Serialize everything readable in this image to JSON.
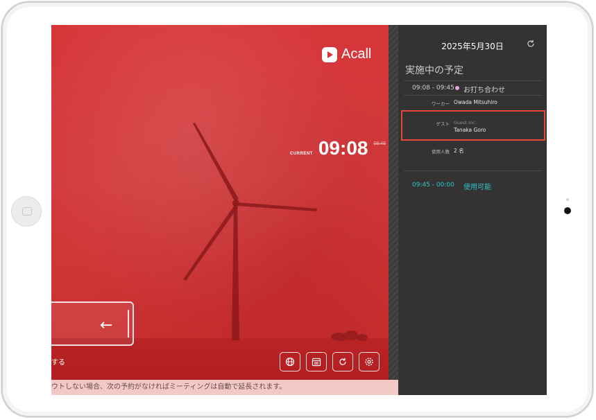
{
  "brand": {
    "name": "Acall"
  },
  "clock": {
    "label": "CURRENT",
    "time": "09:08",
    "end_time": "09:45"
  },
  "checkout": {
    "label": "する"
  },
  "toolbar": {
    "icons": [
      "globe-icon",
      "calendar-icon",
      "refresh-icon",
      "gear-icon"
    ]
  },
  "notice": {
    "text": "ウトしない場合、次の予約がなければミーティングは自動で延長されます。"
  },
  "schedule": {
    "date": "2025年5月30日",
    "section_title": "実施中の予定",
    "current": {
      "time": "09:08 - 09:45",
      "title": "お打ち合わせ",
      "worker_label": "ワーカー",
      "worker": "Owada Mitsuhiro",
      "guest_label": "ゲスト",
      "guest_company": "Guest Inc.",
      "guest_name": "Tanaka Goro",
      "attendees_label": "使用人数",
      "attendees": "2 名"
    },
    "next": {
      "time": "09:45 - 00:00",
      "status": "使用可能"
    }
  },
  "colors": {
    "accent_red": "#d6363a",
    "highlight_border": "#e5473c",
    "available": "#33c3c6",
    "meeting_dot": "#e7a6e0",
    "panel_dark": "#333333"
  }
}
